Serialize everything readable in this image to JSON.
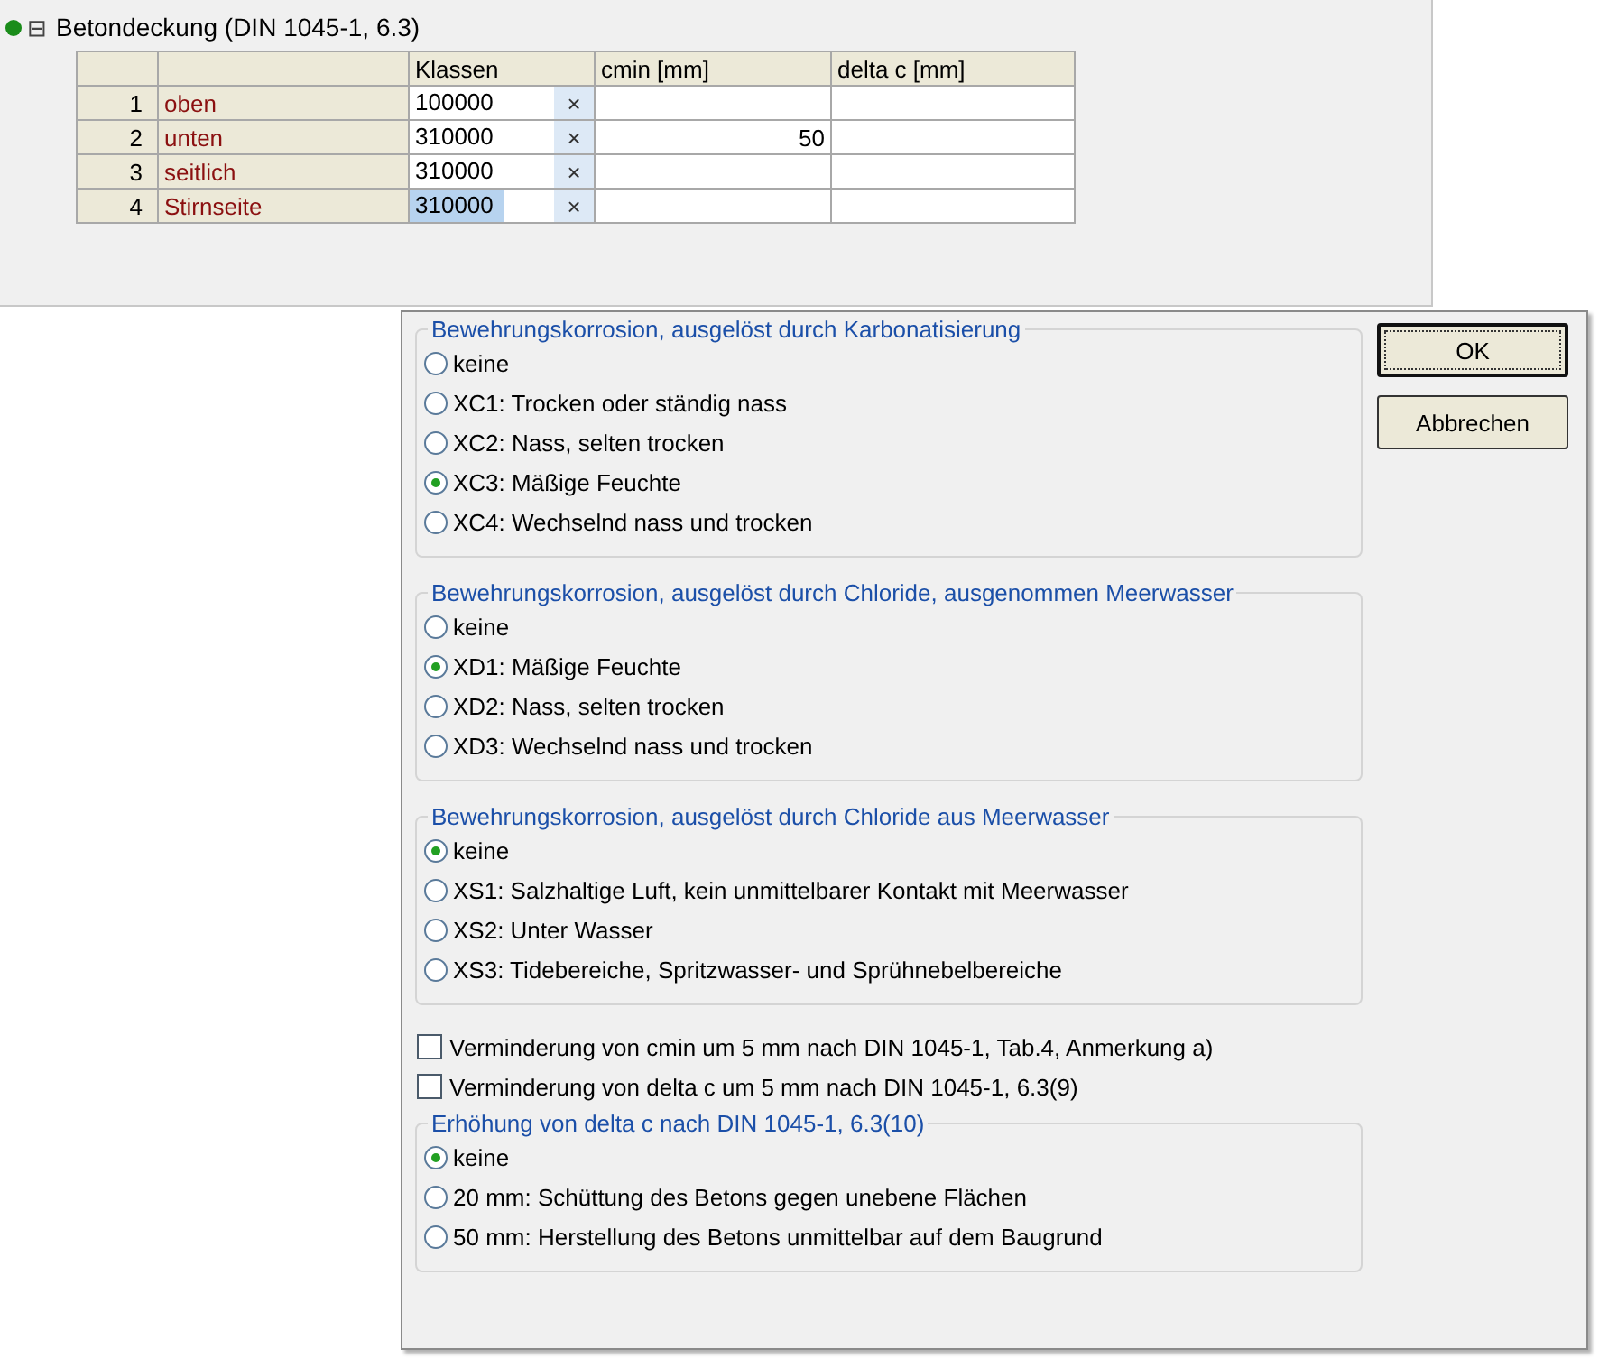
{
  "tree_node": {
    "title": "Betondeckung (DIN 1045-1, 6.3)",
    "expanded": true,
    "expander": "⊟",
    "valid": true
  },
  "table": {
    "columns": [
      "Klassen",
      "cmin [mm]",
      "delta c [mm]"
    ],
    "rows": [
      {
        "number": "1",
        "name": "oben",
        "klassen": "100000",
        "clear": "×",
        "selected": false
      },
      {
        "number": "2",
        "name": "unten",
        "klassen": "310000",
        "clear": "×",
        "cmin": "50",
        "selected": false
      },
      {
        "number": "3",
        "name": "seitlich",
        "klassen": "310000",
        "clear": "×",
        "selected": false
      },
      {
        "number": "4",
        "name": "Stirnseite",
        "klassen": "310000",
        "clear": "×",
        "selected": true
      }
    ]
  },
  "popup": {
    "sections": [
      {
        "kind": "radio_group",
        "legend": "Bewehrungskorrosion, ausgelöst durch Karbonatisierung",
        "options": [
          {
            "label": "keine",
            "selected": false
          },
          {
            "label": "XC1: Trocken oder ständig nass",
            "selected": false
          },
          {
            "label": "XC2: Nass, selten trocken",
            "selected": false
          },
          {
            "label": "XC3: Mäßige Feuchte",
            "selected": true
          },
          {
            "label": "XC4: Wechselnd nass und trocken",
            "selected": false
          }
        ]
      },
      {
        "kind": "radio_group",
        "legend": "Bewehrungskorrosion, ausgelöst durch Chloride, ausgenommen Meerwasser",
        "options": [
          {
            "label": "keine",
            "selected": false
          },
          {
            "label": "XD1: Mäßige Feuchte",
            "selected": true
          },
          {
            "label": "XD2: Nass, selten trocken",
            "selected": false
          },
          {
            "label": "XD3: Wechselnd nass und trocken",
            "selected": false
          }
        ]
      },
      {
        "kind": "radio_group",
        "legend": "Bewehrungskorrosion, ausgelöst durch Chloride aus Meerwasser",
        "options": [
          {
            "label": "keine",
            "selected": true
          },
          {
            "label": "XS1: Salzhaltige Luft, kein unmittelbarer Kontakt mit Meerwasser",
            "selected": false
          },
          {
            "label": "XS2: Unter Wasser",
            "selected": false
          },
          {
            "label": "XS3: Tidebereiche, Spritzwasser- und Sprühnebelbereiche",
            "selected": false
          }
        ]
      },
      {
        "kind": "checkbox",
        "label": "Verminderung von cmin um 5 mm nach DIN 1045-1, Tab.4, Anmerkung a)",
        "checked": false
      },
      {
        "kind": "checkbox",
        "label": "Verminderung von delta c um 5 mm nach DIN 1045-1, 6.3(9)",
        "checked": false
      },
      {
        "kind": "radio_group",
        "legend": "Erhöhung von delta c nach DIN 1045-1, 6.3(10)",
        "options": [
          {
            "label": "keine",
            "selected": true
          },
          {
            "label": "20 mm: Schüttung des Betons gegen unebene Flächen",
            "selected": false
          },
          {
            "label": "50 mm: Herstellung des Betons unmittelbar auf dem Baugrund",
            "selected": false
          }
        ]
      }
    ],
    "buttons": [
      {
        "label": "OK",
        "default": true
      },
      {
        "label": "Abbrechen",
        "default": false
      }
    ]
  }
}
